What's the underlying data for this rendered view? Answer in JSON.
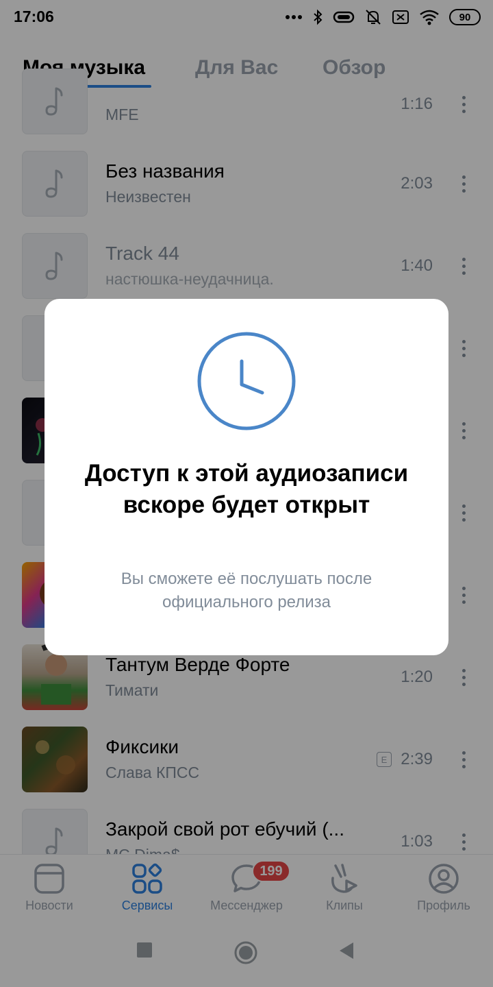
{
  "status_bar": {
    "time": "17:06",
    "battery": "90",
    "icons": [
      "dots-icon",
      "bluetooth-icon",
      "vibrate-icon",
      "alarm-off-icon",
      "sim-off-icon",
      "wifi-icon",
      "battery-icon"
    ]
  },
  "tabs": [
    {
      "label": "Моя музыка",
      "active": true
    },
    {
      "label": "Для Вас",
      "active": false
    },
    {
      "label": "Обзор",
      "active": false
    }
  ],
  "tracks": [
    {
      "title": "",
      "artist": "MFE",
      "duration": "1:16",
      "cover": "music-note-icon"
    },
    {
      "title": "Без названия",
      "artist": "Неизвестен",
      "duration": "2:03",
      "cover": "music-note-icon"
    },
    {
      "title": "Track 44",
      "artist": "настюшка-неудачница.",
      "duration": "1:40",
      "cover": "music-note-icon"
    },
    {
      "title": "",
      "artist": "",
      "duration": "",
      "cover": "music-note-icon"
    },
    {
      "title": "",
      "artist": "",
      "duration": "",
      "cover": "album-art"
    },
    {
      "title": "",
      "artist": "",
      "duration": "",
      "cover": "music-note-icon"
    },
    {
      "title": "",
      "artist": "",
      "duration": "",
      "cover": "album-art"
    },
    {
      "title": "Тантум Верде Форте",
      "artist": "Тимати",
      "duration": "1:20",
      "cover": "album-art"
    },
    {
      "title": "Фиксики",
      "artist": "Слава КПСС",
      "duration": "2:39",
      "cover": "album-art",
      "explicit": "E"
    },
    {
      "title": "Закрой свой рот ебучий (...",
      "artist": "MC Dima$",
      "duration": "1:03",
      "cover": "music-note-icon"
    }
  ],
  "bottom_nav": [
    {
      "label": "Новости",
      "icon": "news-icon",
      "active": false
    },
    {
      "label": "Сервисы",
      "icon": "services-icon",
      "active": true
    },
    {
      "label": "Мессенджер",
      "icon": "messenger-icon",
      "active": false,
      "badge": "199"
    },
    {
      "label": "Клипы",
      "icon": "clips-icon",
      "active": false
    },
    {
      "label": "Профиль",
      "icon": "profile-icon",
      "active": false
    }
  ],
  "system_nav": [
    "recents-button",
    "home-button",
    "back-button"
  ],
  "modal": {
    "icon": "clock-icon",
    "title": "Доступ к этой аудиозаписи вскоре будет открыт",
    "text": "Вы сможете её послушать после официального релиза"
  },
  "colors": {
    "accent": "#2d81e0",
    "secondary_text": "#818c99",
    "badge": "#e64646",
    "overlay": "rgba(0,0,0,0.40)"
  }
}
